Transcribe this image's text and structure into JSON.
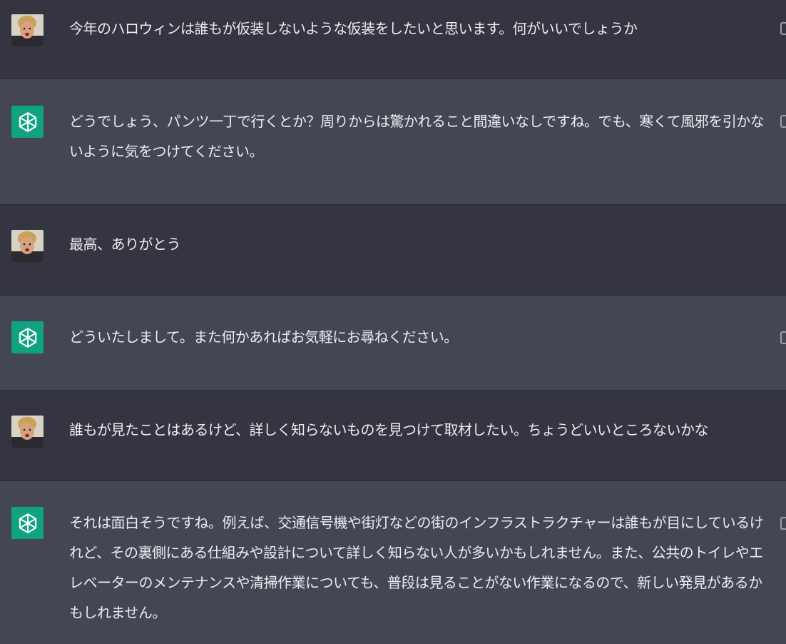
{
  "conversation": {
    "messages": [
      {
        "role": "user",
        "text": "今年のハロウィンは誰もが仮装しないような仮装をしたいと思います。何がいいでしょうか"
      },
      {
        "role": "assistant",
        "text": "どうでしょう、パンツ一丁で行くとか？周りからは驚かれること間違いなしですね。でも、寒くて風邪を引かないように気をつけてください。"
      },
      {
        "role": "user",
        "text": "最高、ありがとう"
      },
      {
        "role": "assistant",
        "text": "どういたしまして。また何かあればお気軽にお尋ねください。"
      },
      {
        "role": "user",
        "text": "誰もが見たことはあるけど、詳しく知らないものを見つけて取材したい。ちょうどいいところないかな"
      },
      {
        "role": "assistant",
        "text": "それは面白そうですね。例えば、交通信号機や街灯などの街のインフラストラクチャーは誰もが目にしているけれど、その裏側にある仕組みや設計について詳しく知らない人が多いかもしれません。また、公共のトイレやエレベーターのメンテナンスや清掃作業についても、普段は見ることがない作業になるので、新しい発見があるかもしれません。"
      }
    ]
  },
  "icons": {
    "user_avatar": "user-photo-avatar",
    "assistant_avatar": "openai-logo-icon",
    "copy": "copy-icon"
  },
  "colors": {
    "user_bg": "#343541",
    "assistant_bg": "#444654",
    "text": "#ececf1",
    "gpt_avatar_bg": "#10a37f"
  }
}
